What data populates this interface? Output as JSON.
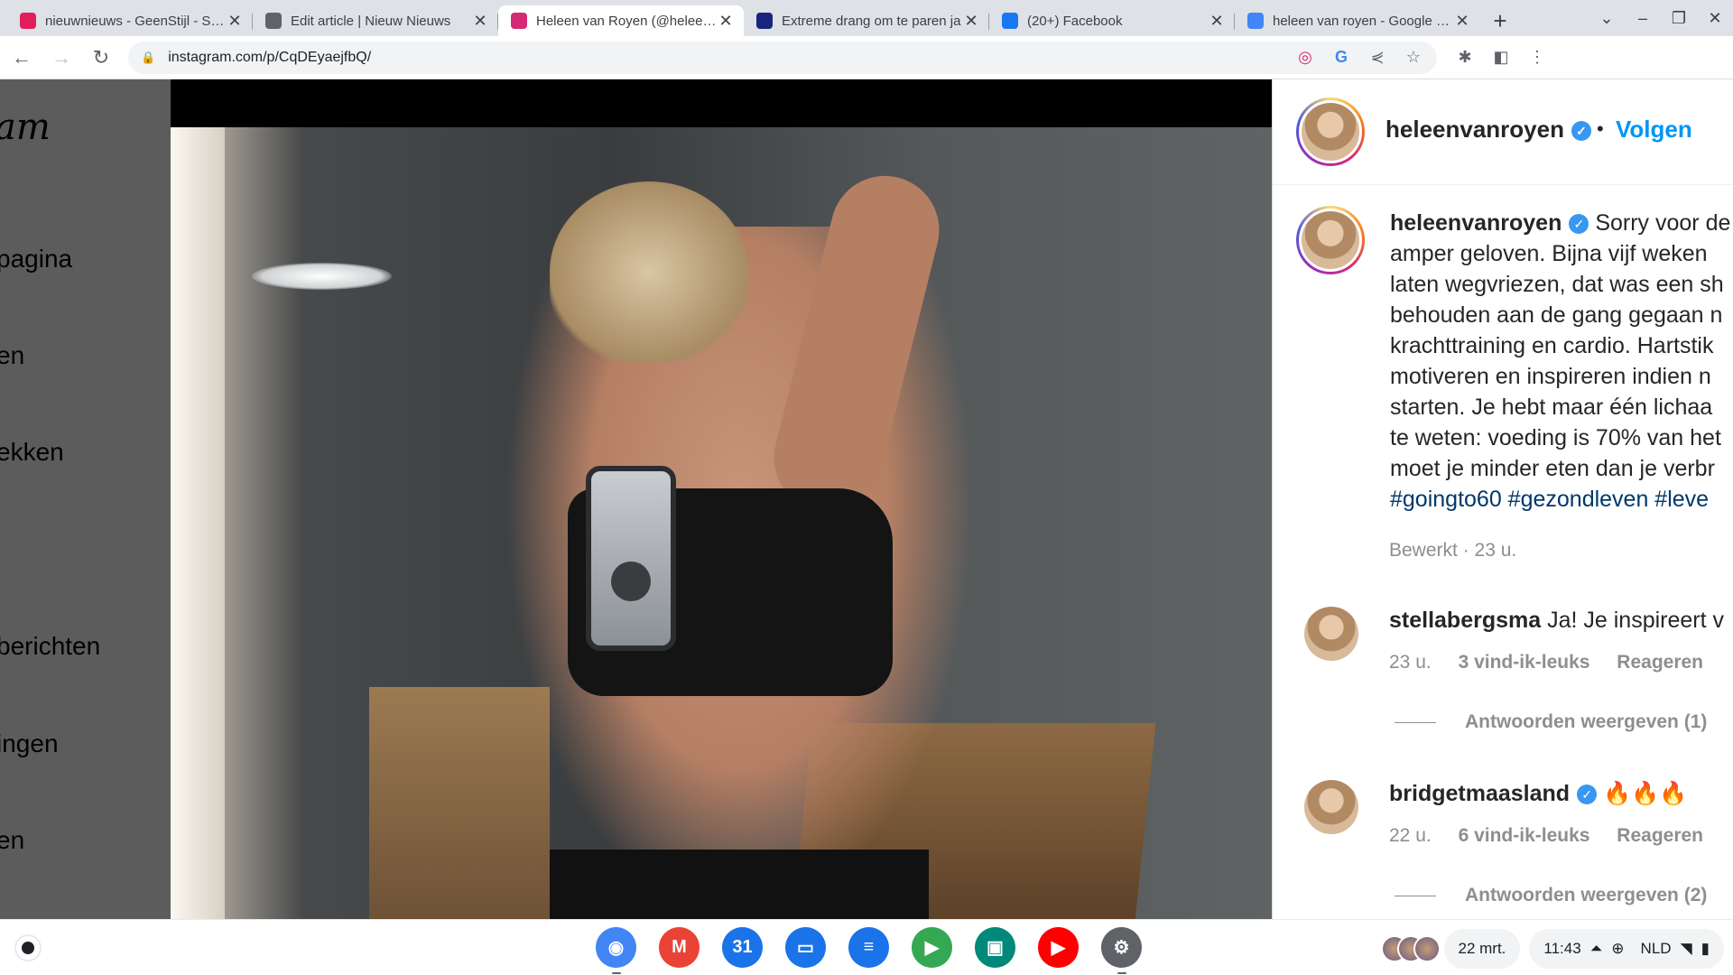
{
  "tabs": [
    {
      "title": "nieuwnieuws - GeenStijl - Slack",
      "favicon": "slack-icon",
      "color": "#e01e5a",
      "active": false
    },
    {
      "title": "Edit article | Nieuw Nieuws",
      "favicon": "globe-icon",
      "color": "#5f6368",
      "active": false
    },
    {
      "title": "Heleen van Royen (@heleenvanroyen)",
      "favicon": "instagram-icon",
      "color": "#d62976",
      "active": true
    },
    {
      "title": "Extreme drang om te paren ja",
      "favicon": "news-icon",
      "color": "#1a237e",
      "active": false
    },
    {
      "title": "(20+) Facebook",
      "favicon": "facebook-icon",
      "color": "#1877f2",
      "active": false
    },
    {
      "title": "heleen van royen - Google Search",
      "favicon": "google-icon",
      "color": "#4285f4",
      "active": false
    }
  ],
  "tab_close_glyph": "✕",
  "new_tab_glyph": "+",
  "address": {
    "url": "instagram.com/p/CqDEyaejfbQ/"
  },
  "left_nav": {
    "logo_fragment": "am",
    "items": [
      "pagina",
      "en",
      "ekken",
      "",
      "berichten",
      "ingen",
      "en"
    ]
  },
  "post": {
    "username": "heleenvanroyen",
    "verified_glyph": "✓",
    "separator": "•",
    "follow_label": "Volgen",
    "caption_lines": [
      "Sorry voor de",
      "amper geloven. Bijna vijf weken",
      "laten wegvriezen, dat was een sh",
      "behouden aan de gang gegaan n",
      "krachttraining en cardio. Hartstik",
      "motiveren en inspireren indien n",
      "starten. Je hebt maar één lichaa",
      "te weten: voeding is 70% van het",
      "moet je minder eten dan je verbr"
    ],
    "hashtags": "#goingto60 #gezondleven #leve",
    "caption_meta": "Bewerkt · 23 u."
  },
  "comments": [
    {
      "username": "stellabergsma",
      "verified": false,
      "text": "Ja! Je inspireert v",
      "time": "23 u.",
      "likes": "3 vind-ik-leuks",
      "reply": "Reageren",
      "view_replies": "Antwoorden weergeven (1)"
    },
    {
      "username": "bridgetmaasland",
      "verified": true,
      "text": "🔥🔥🔥",
      "time": "22 u.",
      "likes": "6 vind-ik-leuks",
      "reply": "Reageren",
      "view_replies": "Antwoorden weergeven (2)"
    }
  ],
  "shelf": {
    "apps": [
      {
        "name": "chrome",
        "color": "#4285f4",
        "glyph": "◉",
        "running": true
      },
      {
        "name": "gmail",
        "color": "#ea4335",
        "glyph": "M",
        "running": false
      },
      {
        "name": "calendar",
        "color": "#1a73e8",
        "glyph": "31",
        "running": false
      },
      {
        "name": "files",
        "color": "#1a73e8",
        "glyph": "▭",
        "running": false
      },
      {
        "name": "messages",
        "color": "#1a73e8",
        "glyph": "≡",
        "running": false
      },
      {
        "name": "play-store",
        "color": "#34a853",
        "glyph": "▶",
        "running": false
      },
      {
        "name": "meet",
        "color": "#00897b",
        "glyph": "▣",
        "running": false
      },
      {
        "name": "youtube",
        "color": "#ff0000",
        "glyph": "▶",
        "running": false
      },
      {
        "name": "settings",
        "color": "#5f6368",
        "glyph": "⚙",
        "running": true
      }
    ],
    "date": "22 mrt.",
    "time": "11:43",
    "locale": "NLD"
  }
}
